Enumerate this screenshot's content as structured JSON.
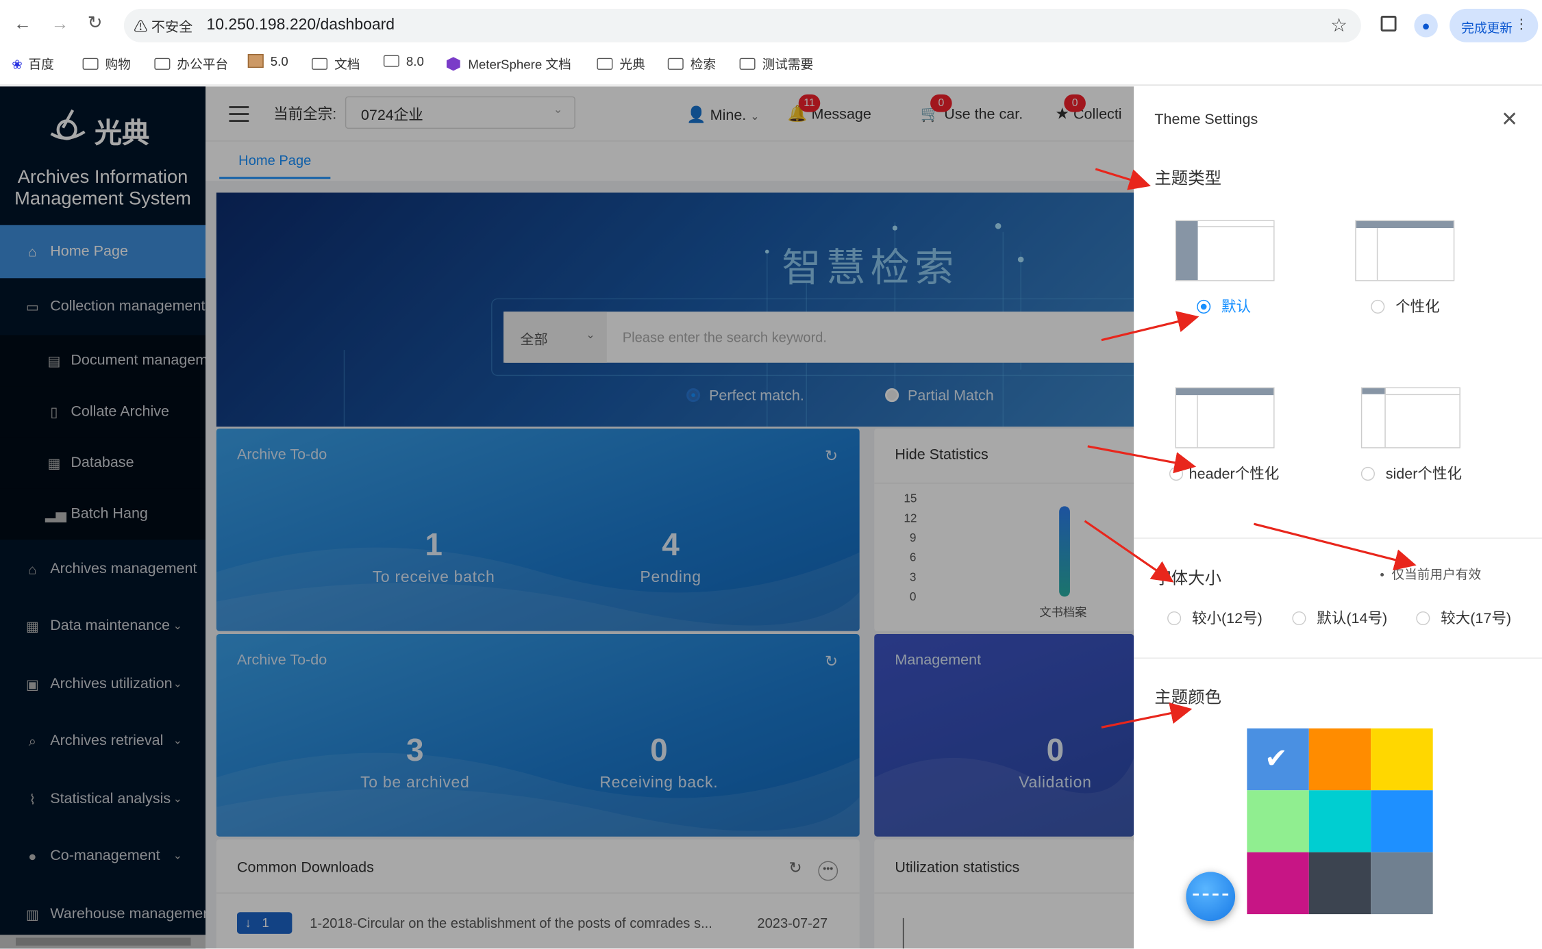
{
  "browser": {
    "security_label": "不安全",
    "url": "10.250.198.220/dashboard",
    "update_button": "完成更新",
    "bookmarks": [
      "百度",
      "购物",
      "办公平台",
      "5.0",
      "文档",
      "8.0",
      "MeterSphere 文档",
      "光典",
      "检索",
      "测试需要"
    ]
  },
  "sidebar": {
    "logo_text": "光典",
    "system_title_line1": "Archives Information",
    "system_title_line2": "Management System",
    "items": [
      {
        "label": "Home Page",
        "icon": "home-icon"
      },
      {
        "label": "Collection management",
        "icon": "box-icon"
      },
      {
        "label": "Document management",
        "icon": "document-icon"
      },
      {
        "label": "Collate Archive",
        "icon": "file-icon"
      },
      {
        "label": "Database",
        "icon": "calendar-icon"
      },
      {
        "label": "Batch Hang",
        "icon": "chart-icon"
      },
      {
        "label": "Archives management",
        "icon": "bank-icon"
      },
      {
        "label": "Data maintenance",
        "icon": "grid-icon"
      },
      {
        "label": "Archives utilization",
        "icon": "clipboard-icon"
      },
      {
        "label": "Archives retrieval",
        "icon": "search-icon"
      },
      {
        "label": "Statistical analysis",
        "icon": "line-chart-icon"
      },
      {
        "label": "Co-management",
        "icon": "user-icon"
      },
      {
        "label": "Warehouse management",
        "icon": "building-icon"
      }
    ]
  },
  "topbar": {
    "unit_label": "当前全宗:",
    "unit_value": "0724企业",
    "user": "Mine.",
    "message_label": "Message",
    "message_count": "11",
    "cart_label": "Use the car.",
    "cart_count": "0",
    "collect_label": "Collecti",
    "collect_count": "0"
  },
  "tabs": {
    "home": "Home Page"
  },
  "banner": {
    "title": "智慧检索",
    "scope": "全部",
    "placeholder": "Please enter the search keyword.",
    "match_exact": "Perfect match.",
    "match_partial": "Partial Match"
  },
  "cards": {
    "todo1": {
      "title": "Archive To-do",
      "a_value": "1",
      "a_label": "To receive batch",
      "b_value": "4",
      "b_label": "Pending"
    },
    "todo2": {
      "title": "Archive To-do",
      "a_value": "3",
      "a_label": "To be archived",
      "b_value": "0",
      "b_label": "Receiving back."
    },
    "management": {
      "title": "Management",
      "value": "0",
      "label": "Validation"
    },
    "hide_stats": {
      "title": "Hide Statistics",
      "yticks": [
        "15",
        "12",
        "9",
        "6",
        "3",
        "0"
      ],
      "category": "文书档案"
    },
    "downloads": {
      "title": "Common Downloads",
      "row_index": "1",
      "row_title": "1-2018-Circular on the establishment of the posts of comrades s...",
      "row_date": "2023-07-27"
    },
    "utilization": {
      "title": "Utilization statistics"
    }
  },
  "drawer": {
    "title": "Theme Settings",
    "theme_type_title": "主题类型",
    "layouts": [
      "默认",
      "个性化",
      "header个性化",
      "sider个性化"
    ],
    "selected_layout": "默认",
    "font_size_title": "字体大小",
    "font_note": "仅当前用户有效",
    "font_sizes": [
      "较小(12号)",
      "默认(14号)",
      "较大(17号)"
    ],
    "color_title": "主题颜色",
    "colors": [
      "#4a90e2",
      "#ff8c00",
      "#ffd700",
      "#90ee90",
      "#00ced1",
      "#1e90ff",
      "#c71585",
      "#3c4450",
      "#708090"
    ],
    "selected_color": "#4a90e2"
  }
}
